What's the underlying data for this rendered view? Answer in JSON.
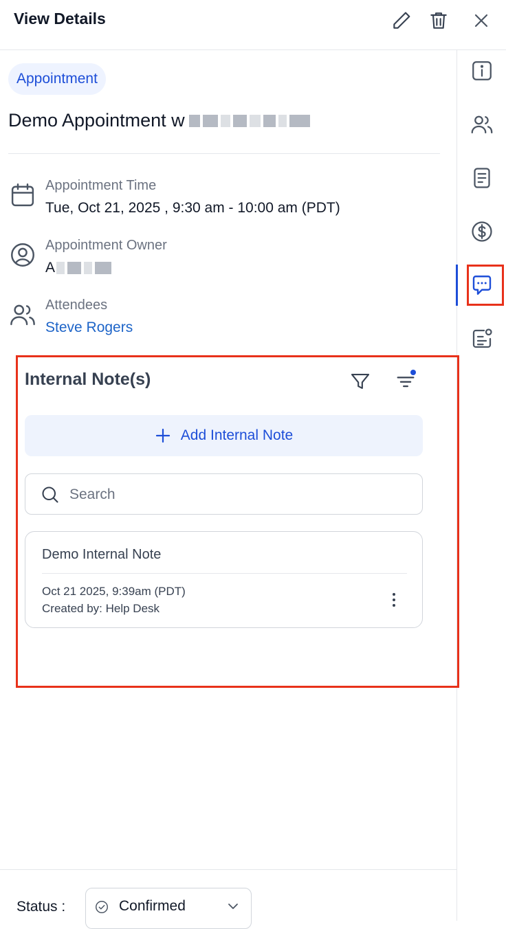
{
  "header": {
    "title": "View Details"
  },
  "appointment": {
    "type_badge": "Appointment",
    "title_visible": "Demo Appointment w",
    "time_label": "Appointment Time",
    "time_value": "Tue, Oct 21, 2025 , 9:30 am - 10:00 am (PDT)",
    "owner_label": "Appointment Owner",
    "owner_initial": "A",
    "attendees_label": "Attendees",
    "attendee": "Steve Rogers"
  },
  "notes": {
    "title": "Internal Note(s)",
    "add_label": "Add Internal Note",
    "search_placeholder": "Search",
    "items": [
      {
        "title": "Demo Internal Note",
        "date": "Oct 21 2025, 9:39am (PDT)",
        "created_by": "Created by: Help Desk"
      }
    ]
  },
  "footer": {
    "status_label": "Status :",
    "status_value": "Confirmed"
  },
  "colors": {
    "accent": "#1d4ed8",
    "link": "#1d64c8",
    "highlight": "#e8311a"
  }
}
